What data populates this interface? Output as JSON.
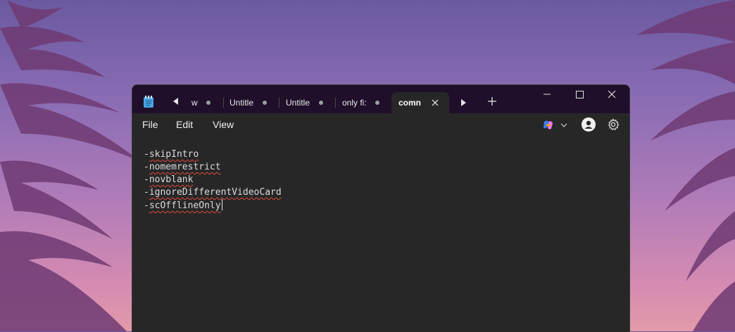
{
  "app": {
    "icon": "notepad-icon"
  },
  "tabs": [
    {
      "label": "w",
      "modified": true
    },
    {
      "label": "Untitle",
      "modified": true
    },
    {
      "label": "Untitle",
      "modified": true
    },
    {
      "label": "only fi:",
      "modified": true
    },
    {
      "label": "comn",
      "active": true
    }
  ],
  "menu": {
    "file": "File",
    "edit": "Edit",
    "view": "View"
  },
  "toolbar": {
    "copilot_icon": "copilot-icon",
    "account_icon": "account-icon",
    "settings_icon": "gear-icon"
  },
  "editor": {
    "dash": "-",
    "lines": [
      "skipIntro",
      "nomemrestrict",
      "novblank",
      "ignoreDifferentVideoCard",
      "scOfflineOnly"
    ]
  }
}
